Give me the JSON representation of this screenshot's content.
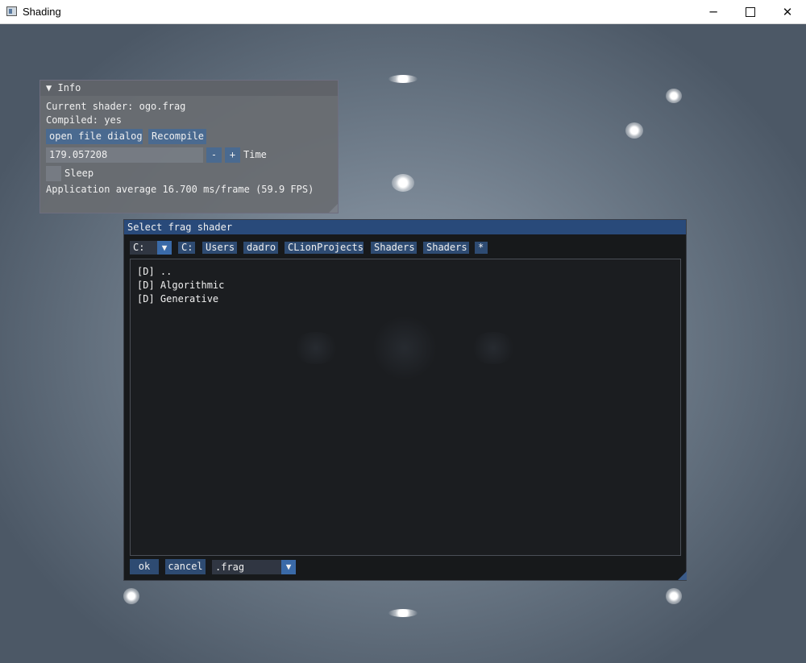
{
  "window": {
    "title": "Shading",
    "controls": {
      "minimize": "─",
      "close": "✕"
    }
  },
  "info_panel": {
    "title": "Info",
    "collapse_arrow": "▼",
    "current_shader_label": "Current shader: ogo.frag",
    "compiled_label": "Compiled: yes",
    "open_file_dialog_label": "open file dialog",
    "recompile_label": "Recompile",
    "time_value": "179.057208",
    "minus_label": "-",
    "plus_label": "+",
    "time_label": "Time",
    "sleep_label": "Sleep",
    "fps_text": "Application average 16.700 ms/frame (59.9 FPS)"
  },
  "file_dialog": {
    "title": "Select frag shader",
    "drive_selected": "C:",
    "path_segments": [
      "C:",
      "Users",
      "dadro",
      "CLionProjects",
      "Shaders",
      "Shaders",
      "*"
    ],
    "entries": [
      "[D] ..",
      "[D] Algorithmic",
      "[D] Generative"
    ],
    "ok_label": "ok",
    "cancel_label": "cancel",
    "filter_selected": ".frag",
    "combo_arrow": "▼"
  },
  "colors": {
    "dialog_title_bg": "#294a7a",
    "button_bg": "#4a6a90",
    "path_button_bg": "#2e4b72",
    "combo_arrow_bg": "#3a6aa8"
  }
}
